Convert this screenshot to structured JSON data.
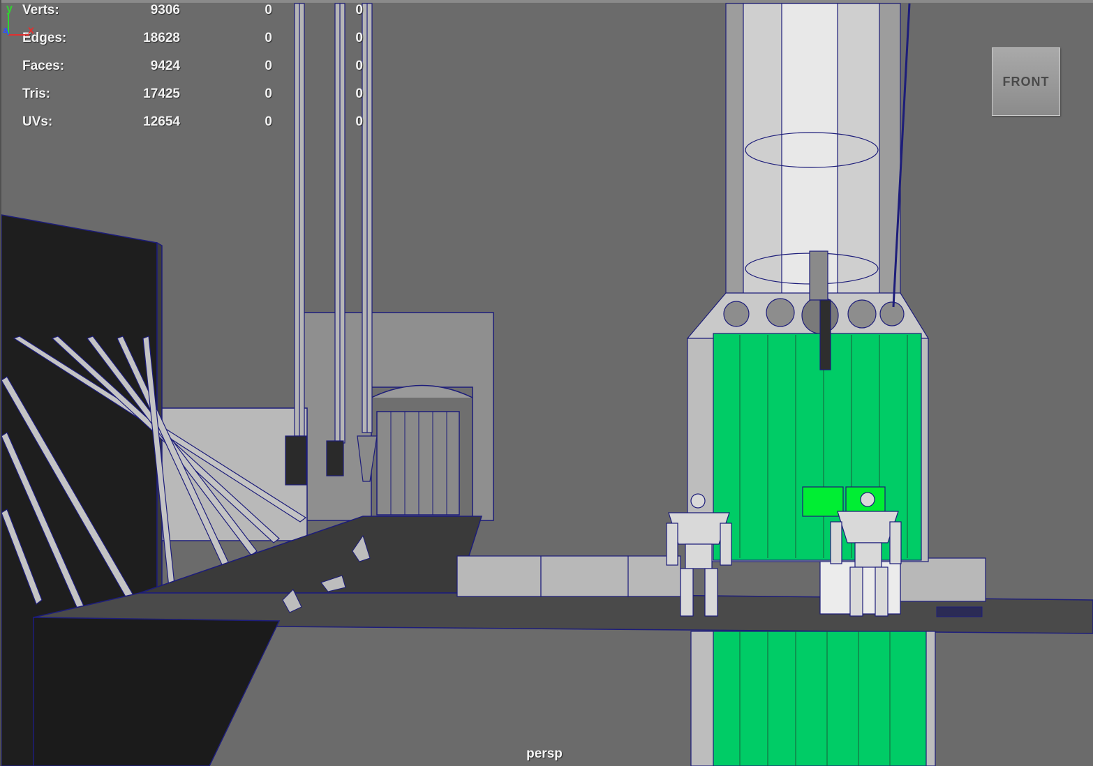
{
  "stats": [
    {
      "label": "Verts:",
      "count": "9306",
      "selected": "0",
      "component": "0"
    },
    {
      "label": "Edges:",
      "count": "18628",
      "selected": "0",
      "component": "0"
    },
    {
      "label": "Faces:",
      "count": "9424",
      "selected": "0",
      "component": "0"
    },
    {
      "label": "Tris:",
      "count": "17425",
      "selected": "0",
      "component": "0"
    },
    {
      "label": "UVs:",
      "count": "12654",
      "selected": "0",
      "component": "0"
    }
  ],
  "view_cube": {
    "face_label": "FRONT"
  },
  "camera": {
    "name": "persp"
  },
  "axis_gizmo": {
    "y_label": "y",
    "x_label": "x",
    "z_label": "z"
  },
  "colors": {
    "background": "#6b6b6b",
    "wire": "#1d1d7a",
    "selection_green": "#00cc66",
    "shade_light": "#d6d6d6",
    "shade_dark": "#1c1c1c"
  }
}
